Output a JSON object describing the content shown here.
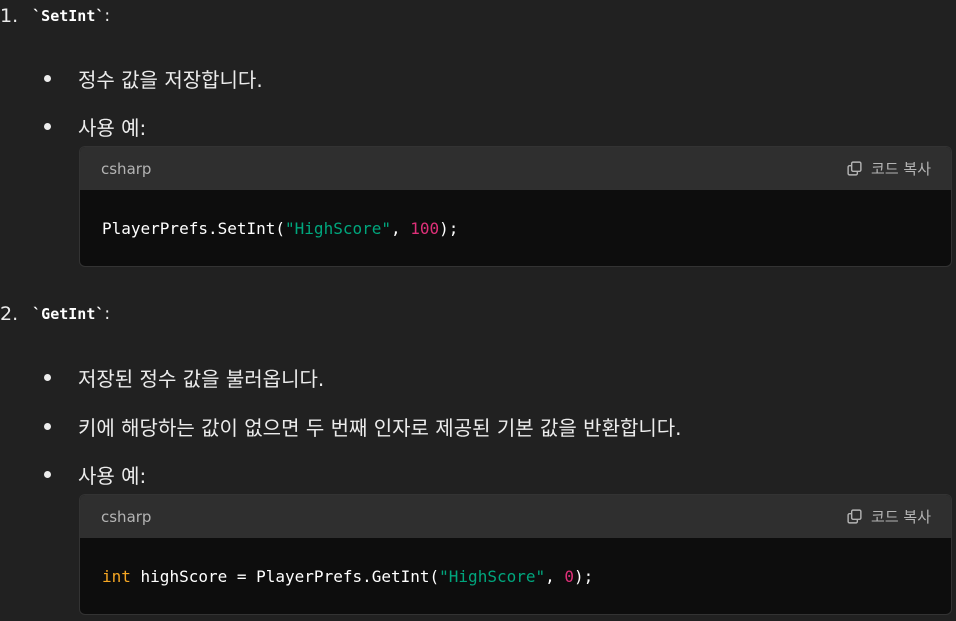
{
  "items": [
    {
      "number": "1.",
      "code_name": "`SetInt`",
      "colon": ":",
      "bullets": [
        "정수 값을 저장합니다.",
        "사용 예:"
      ],
      "codeblock": {
        "language": "csharp",
        "copy_label": "코드 복사",
        "tokens": {
          "prefix": "PlayerPrefs.SetInt(",
          "str": "\"HighScore\"",
          "sep": ", ",
          "num": "100",
          "suffix": ");"
        }
      }
    },
    {
      "number": "2.",
      "code_name": "`GetInt`",
      "colon": ":",
      "bullets": [
        "저장된 정수 값을 불러옵니다.",
        "키에 해당하는 값이 없으면 두 번째 인자로 제공된 기본 값을 반환합니다.",
        "사용 예:"
      ],
      "codeblock": {
        "language": "csharp",
        "copy_label": "코드 복사",
        "tokens": {
          "kw": "int",
          "prefix": " highScore = PlayerPrefs.GetInt(",
          "str": "\"HighScore\"",
          "sep": ", ",
          "num": "0",
          "suffix": ");"
        }
      }
    }
  ],
  "colors": {
    "background": "#212121",
    "code_bg": "#0d0d0d",
    "code_header_bg": "#2f2f2f",
    "string": "#00a67d",
    "number": "#df3079",
    "keyword": "#f5a623"
  },
  "icons": {
    "copy": "copy-icon"
  }
}
